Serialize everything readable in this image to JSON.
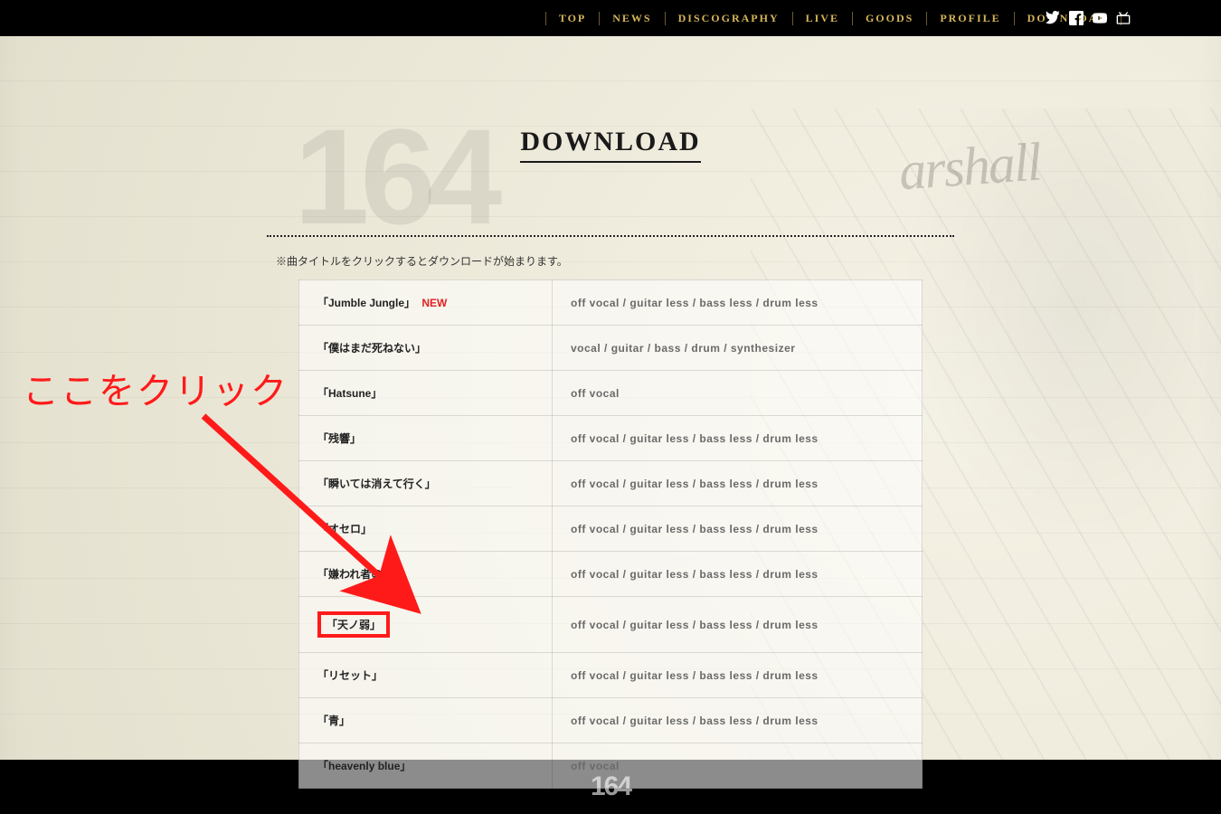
{
  "nav": {
    "items": [
      {
        "label": "TOP"
      },
      {
        "label": "NEWS"
      },
      {
        "label": "DISCOGRAPHY"
      },
      {
        "label": "LIVE"
      },
      {
        "label": "GOODS"
      },
      {
        "label": "PROFILE"
      },
      {
        "label": "DOWNLOAD"
      }
    ]
  },
  "logo": "164",
  "amp_brand": "arshall",
  "page_title": "DOWNLOAD",
  "instruction": "※曲タイトルをクリックするとダウンロードが始まります。",
  "new_label": "NEW",
  "annotation_text": "ここをクリック",
  "footer_logo": "164",
  "tracks": [
    {
      "title": "「Jumble Jungle」",
      "desc": "off vocal / guitar less / bass less / drum less",
      "is_new": true
    },
    {
      "title": "「僕はまだ死ねない」",
      "desc": "vocal / guitar / bass / drum /  synthesizer"
    },
    {
      "title": "「Hatsune」",
      "desc": "off vocal"
    },
    {
      "title": "「残響」",
      "desc": "off vocal / guitar less / bass less / drum less"
    },
    {
      "title": "「瞬いては消えて行く」",
      "desc": "off vocal / guitar less / bass less / drum less"
    },
    {
      "title": "「オセロ」",
      "desc": "off vocal / guitar less / bass less / drum less"
    },
    {
      "title": "「嫌われ者の詩」",
      "desc": "off vocal / guitar less / bass less / drum less"
    },
    {
      "title": "「天ノ弱」",
      "desc": "off vocal / guitar less / bass less / drum less",
      "highlighted": true
    },
    {
      "title": "「リセット」",
      "desc": "off vocal / guitar less / bass less / drum less"
    },
    {
      "title": "「青」",
      "desc": "off vocal / guitar less / bass less / drum less"
    },
    {
      "title": "「heavenly blue」",
      "desc": "off vocal"
    }
  ]
}
